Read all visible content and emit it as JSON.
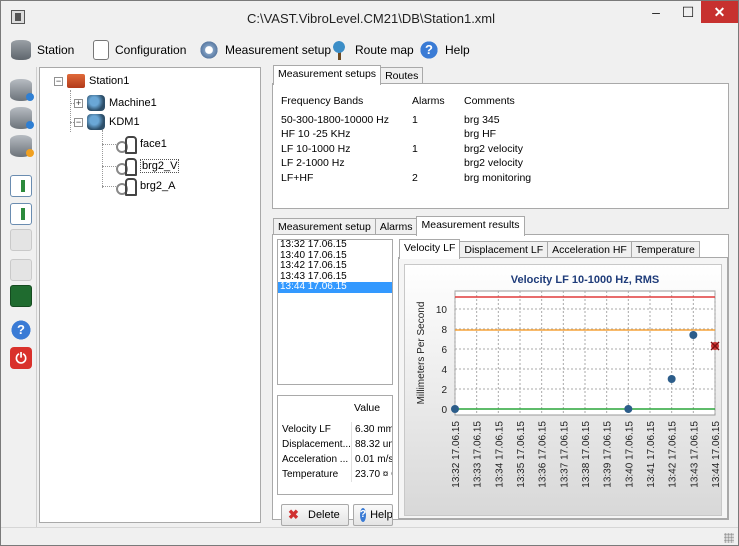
{
  "window": {
    "title": "C:\\VAST.VibroLevel.CM21\\DB\\Station1.xml",
    "minimize": "–",
    "maximize": "☐",
    "close": "✕"
  },
  "menu": [
    {
      "label": "Station",
      "icon": "database-icon"
    },
    {
      "label": "Configuration",
      "icon": "document-icon"
    },
    {
      "label": "Measurement setup",
      "icon": "gear-icon"
    },
    {
      "label": "Route map",
      "icon": "route-pin-icon"
    },
    {
      "label": "Help",
      "icon": "help-icon"
    }
  ],
  "left_toolbar": {
    "help": "?",
    "power": "⏻"
  },
  "tree": {
    "root": "Station1",
    "machine1": "Machine1",
    "kdm1": "KDM1",
    "points": [
      "face1",
      "brg2_V",
      "brg2_A"
    ],
    "selected": "brg2_V"
  },
  "setups_tabs": [
    "Measurement setups",
    "Routes"
  ],
  "setups_table": {
    "headers": [
      "Frequency Bands",
      "Alarms",
      "Comments"
    ],
    "rows": [
      [
        "50-300-1800-10000 Hz",
        "1",
        "brg 345"
      ],
      [
        "HF 10 -25 KHz",
        "",
        "brg HF"
      ],
      [
        "LF 10-1000 Hz",
        "1",
        "brg2 velocity"
      ],
      [
        "LF 2-1000 Hz",
        "",
        "brg2 velocity"
      ],
      [
        "LF+HF",
        "2",
        "brg monitoring"
      ]
    ]
  },
  "lower_tabs": [
    "Measurement setup",
    "Alarms",
    "Measurement results"
  ],
  "times": [
    "13:32 17.06.15",
    "13:40 17.06.15",
    "13:42 17.06.15",
    "13:43 17.06.15",
    "13:44 17.06.15"
  ],
  "selected_time": "13:44 17.06.15",
  "values": {
    "header": "Value",
    "rows": [
      {
        "name": "Velocity LF",
        "value": "6.30 mm/"
      },
      {
        "name": "Displacement...",
        "value": "88.32 um"
      },
      {
        "name": "Acceleration ...",
        "value": "0.01 m/s"
      },
      {
        "name": "Temperature",
        "value": "23.70 ¤ C"
      }
    ]
  },
  "buttons": {
    "delete": "Delete",
    "help": "Help"
  },
  "chart_tabs": [
    "Velocity LF",
    "Displacement LF",
    "Acceleration HF",
    "Temperature"
  ],
  "chart_data": {
    "type": "scatter",
    "title": "Velocity LF 10-1000 Hz, RMS",
    "ylabel": "Millimeters Per Second",
    "xlabel": "",
    "ylim": [
      -0.6,
      11.8
    ],
    "yticks": [
      0,
      2,
      4,
      6,
      8,
      10
    ],
    "categories": [
      "13:32 17.06.15",
      "13:33 17.06.15",
      "13:34 17.06.15",
      "13:35 17.06.15",
      "13:36 17.06.15",
      "13:37 17.06.15",
      "13:38 17.06.15",
      "13:39 17.06.15",
      "13:40 17.06.15",
      "13:41 17.06.15",
      "13:42 17.06.15",
      "13:43 17.06.15",
      "13:44 17.06.15"
    ],
    "points": [
      {
        "x": "13:32 17.06.15",
        "y": 0.0
      },
      {
        "x": "13:40 17.06.15",
        "y": 0.0
      },
      {
        "x": "13:42 17.06.15",
        "y": 3.0
      },
      {
        "x": "13:43 17.06.15",
        "y": 7.4
      },
      {
        "x": "13:44 17.06.15",
        "y": 6.3,
        "selected": true
      }
    ],
    "alarm_lines": [
      {
        "y": 11.2,
        "color": "#e03c3c"
      },
      {
        "y": 7.9,
        "color": "#f5a33a"
      },
      {
        "y": 0.0,
        "color": "#2aa53a"
      }
    ],
    "grid": true,
    "point_color": "#2c5d8a",
    "selected_color": "#cc3333"
  }
}
